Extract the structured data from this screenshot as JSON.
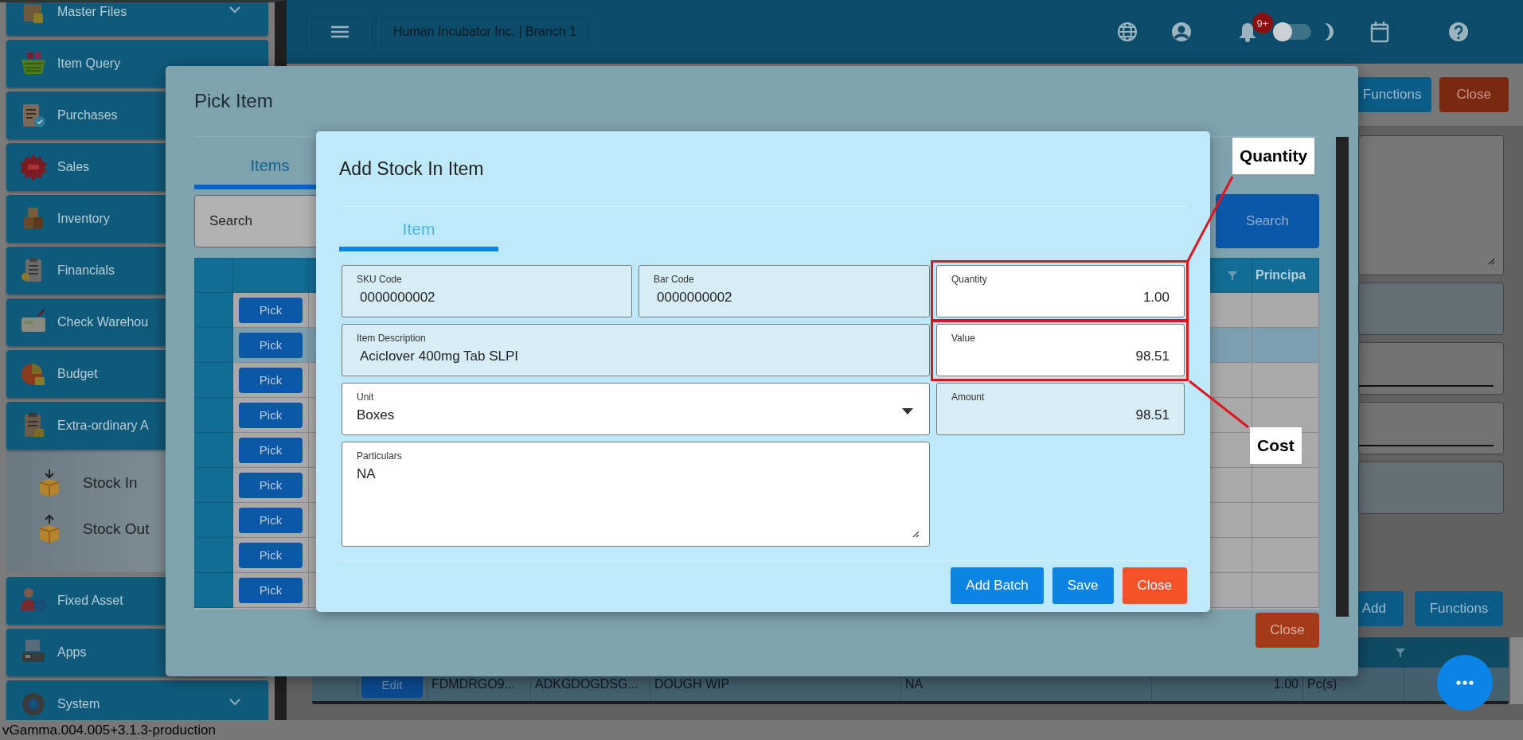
{
  "sidebar": {
    "items": [
      {
        "label": "Master Files",
        "expanded": false
      },
      {
        "label": "Item Query"
      },
      {
        "label": "Purchases"
      },
      {
        "label": "Sales"
      },
      {
        "label": "Inventory"
      },
      {
        "label": "Financials"
      },
      {
        "label": "Check Warehou"
      },
      {
        "label": "Budget"
      },
      {
        "label": "Extra-ordinary A",
        "expanded": true,
        "children": [
          {
            "label": "Stock In"
          },
          {
            "label": "Stock Out"
          }
        ]
      },
      {
        "label": "Fixed Asset"
      },
      {
        "label": "Apps"
      },
      {
        "label": "System",
        "expanded": false
      }
    ]
  },
  "topbar": {
    "branch": "Human Incubator Inc. | Branch 1",
    "notification_badge": "9+",
    "dark_mode": false
  },
  "page": {
    "toolbar_buttons": [
      {
        "label": "Functions",
        "kind": "primary"
      },
      {
        "label": "Close",
        "kind": "danger"
      }
    ],
    "lower_buttons": [
      {
        "label": "Add",
        "kind": "primary"
      },
      {
        "label": "Functions",
        "kind": "primary"
      }
    ],
    "table": {
      "rows": [
        {
          "action": "Edit",
          "cells": [
            "FDMDRGO9...",
            "ADKGDOGDSG...",
            "DOUGH WIP",
            "NA",
            "1.00",
            "Pc(s)"
          ]
        }
      ]
    }
  },
  "pick_item": {
    "title": "Pick Item",
    "tabs": [
      {
        "label": "Items",
        "selected": true
      }
    ],
    "search": {
      "placeholder": "Search"
    },
    "search_button": "Search",
    "table": {
      "columns": [
        {
          "label": "Principa"
        }
      ],
      "rows": [
        {
          "action": "Pick",
          "selected": false
        },
        {
          "action": "Pick",
          "selected": true
        },
        {
          "action": "Pick",
          "selected": false
        },
        {
          "action": "Pick",
          "selected": false
        },
        {
          "action": "Pick",
          "selected": false
        },
        {
          "action": "Pick",
          "selected": false
        },
        {
          "action": "Pick",
          "selected": false
        },
        {
          "action": "Pick",
          "selected": false
        },
        {
          "action": "Pick",
          "selected": false
        }
      ]
    },
    "close_button": "Close"
  },
  "dialog": {
    "title": "Add Stock In Item",
    "tabs": [
      {
        "label": "Item",
        "selected": true
      }
    ],
    "fields": [
      {
        "label": "SKU Code",
        "value": "0000000002",
        "kind": "readonly"
      },
      {
        "label": "Bar Code",
        "value": "0000000002",
        "kind": "readonly"
      },
      {
        "label": "Quantity",
        "value": "1.00",
        "kind": "number",
        "callout": "Quantity"
      },
      {
        "label": "Item Description",
        "value": "Aciclover 400mg Tab SLPI",
        "kind": "readonly"
      },
      {
        "label": "Value",
        "value": "98.51",
        "kind": "number",
        "callout": "Cost"
      },
      {
        "label": "Unit",
        "value": "Boxes",
        "kind": "select"
      },
      {
        "label": "Amount",
        "value": "98.51",
        "kind": "readonly_number"
      },
      {
        "label": "Particulars",
        "value": "NA",
        "kind": "textarea"
      }
    ],
    "buttons": [
      {
        "label": "Add Batch",
        "kind": "primary"
      },
      {
        "label": "Save",
        "kind": "primary"
      },
      {
        "label": "Close",
        "kind": "danger"
      }
    ]
  },
  "version": "vGamma.004.005+3.1.3-production"
}
